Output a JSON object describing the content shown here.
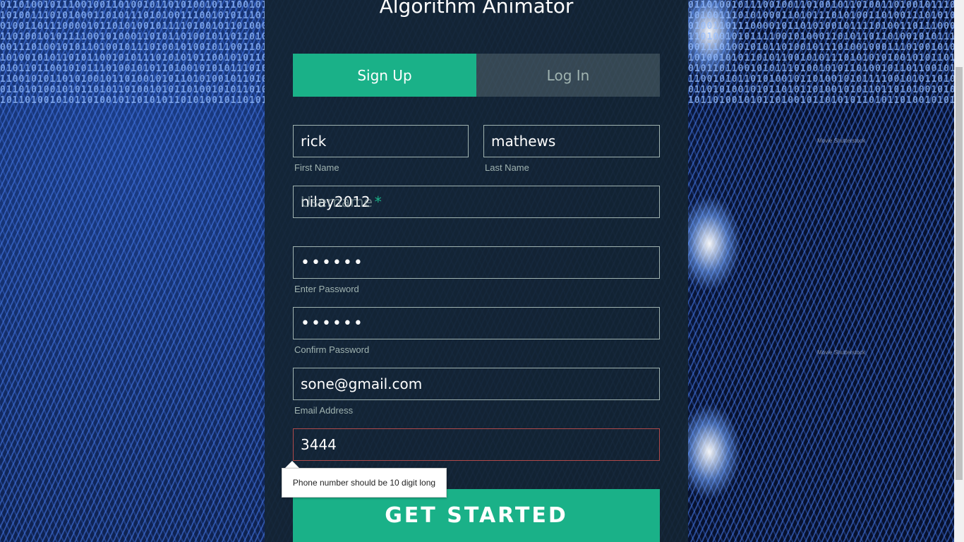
{
  "background": {
    "binary_text": "0110100101110010011010010110101001011100101101\n1010011101010001101011101010011100101011101001\n0100110111000010110101001011110100101101000101\n1101001010111100101000110101101001011011010100\n0011101001010110100101110100101001011001101001\n1010010101101011001010111010101011001010110100\n0101101100101011101001010110100101010111010010\n1100101011010100101101001010110101001011010110\n0110101001010110101101001010110100101011010010\n1011010010101101001011010101101010010110101001",
    "watermark": "Movie Shutterstock"
  },
  "header": {
    "title": "Algorithm Animator"
  },
  "tabs": {
    "signup": "Sign Up",
    "login": "Log In"
  },
  "form": {
    "first_name": {
      "value": "rick",
      "label": "First Name"
    },
    "last_name": {
      "value": "mathews",
      "label": "Last Name"
    },
    "username": {
      "value": "nilay2012",
      "ghost_label": "Username",
      "required_mark": "*"
    },
    "password": {
      "value": "••••••",
      "label": "Enter Password"
    },
    "confirm_password": {
      "value": "••••••",
      "label": "Confirm Password"
    },
    "email": {
      "value": "sone@gmail.com",
      "label": "Email Address"
    },
    "phone": {
      "value": "3444"
    }
  },
  "validation": {
    "phone_error": "Phone number should be 10 digit long"
  },
  "cta": {
    "label": "GET STARTED"
  },
  "colors": {
    "accent": "#1ab188",
    "panel": "#142432",
    "muted": "#a0b3b0",
    "error_border": "#b04a4a"
  }
}
